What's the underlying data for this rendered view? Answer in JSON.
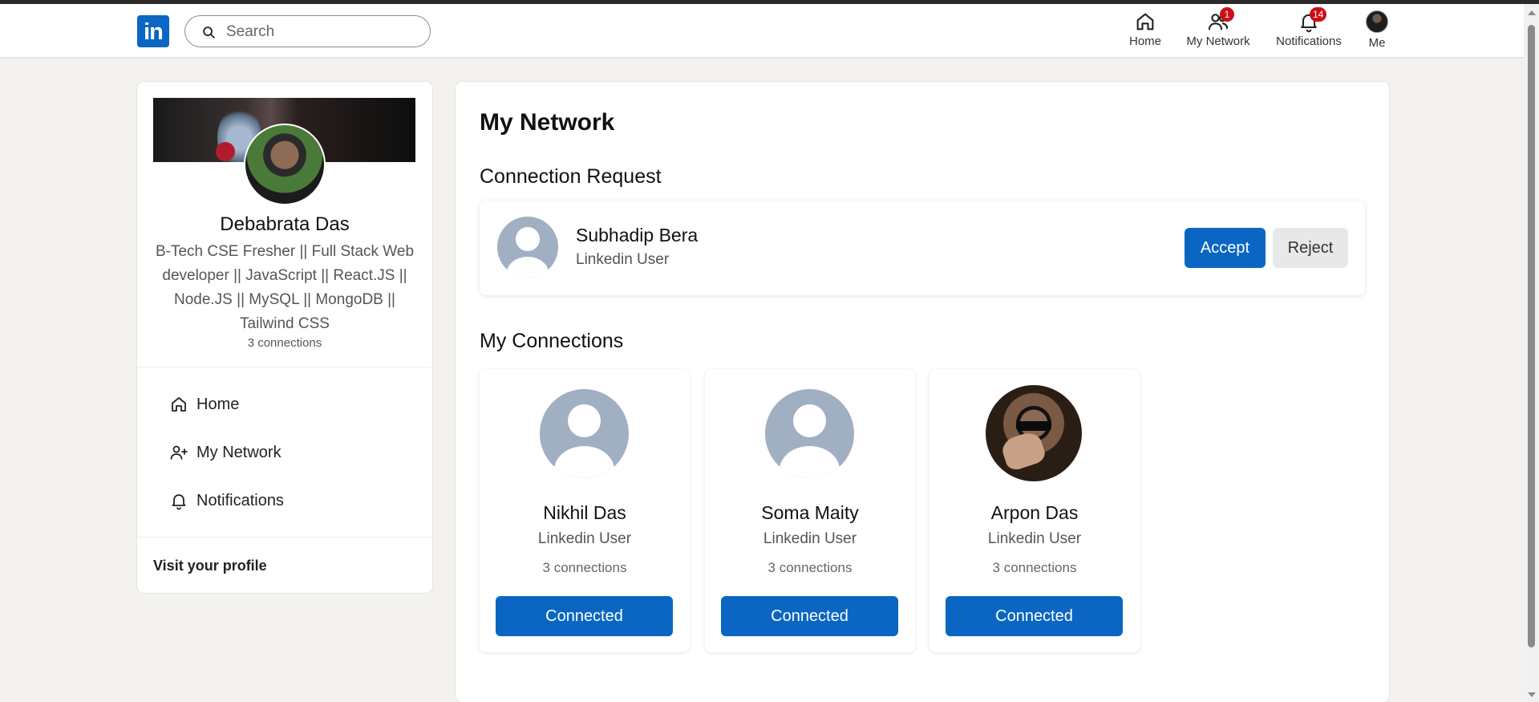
{
  "colors": {
    "brand": "#0a66c2",
    "badge": "#cc1016",
    "background": "#f4f2ee"
  },
  "navbar": {
    "logo_text": "in",
    "search_placeholder": "Search",
    "items": [
      {
        "label": "Home",
        "icon": "home-icon",
        "badge": ""
      },
      {
        "label": "My Network",
        "icon": "network-icon",
        "badge": "1"
      },
      {
        "label": "Notifications",
        "icon": "bell-icon",
        "badge": "14"
      },
      {
        "label": "Me",
        "icon": "avatar",
        "badge": ""
      }
    ]
  },
  "profile": {
    "name": "Debabrata Das",
    "headline": "B-Tech CSE Fresher || Full Stack Web developer || JavaScript || React.JS || Node.JS || MySQL || MongoDB || Tailwind CSS",
    "connections": "3 connections",
    "nav": [
      {
        "label": "Home",
        "icon": "home-icon"
      },
      {
        "label": "My Network",
        "icon": "add-user-icon"
      },
      {
        "label": "Notifications",
        "icon": "bell-icon"
      }
    ],
    "visit_label": "Visit your profile"
  },
  "main": {
    "title": "My Network",
    "requests_title": "Connection Request",
    "request": {
      "name": "Subhadip Bera",
      "subtitle": "Linkedin User",
      "accept_label": "Accept",
      "reject_label": "Reject"
    },
    "connections_title": "My Connections",
    "connections": [
      {
        "name": "Nikhil Das",
        "subtitle": "Linkedin User",
        "count": "3 connections",
        "button": "Connected",
        "avatar": "default"
      },
      {
        "name": "Soma Maity",
        "subtitle": "Linkedin User",
        "count": "3 connections",
        "button": "Connected",
        "avatar": "default"
      },
      {
        "name": "Arpon Das",
        "subtitle": "Linkedin User",
        "count": "3 connections",
        "button": "Connected",
        "avatar": "photo"
      }
    ]
  }
}
